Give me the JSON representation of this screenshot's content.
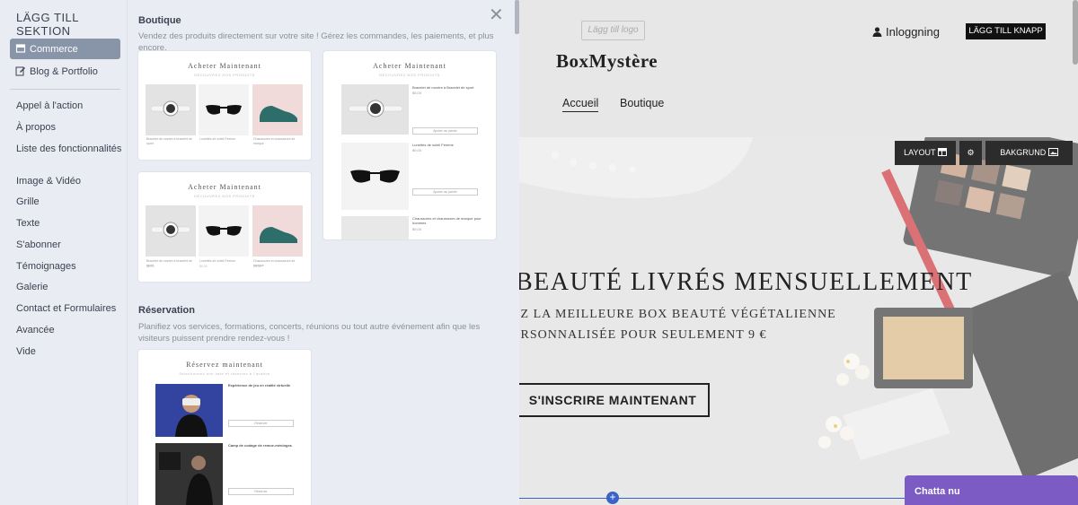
{
  "sidebar": {
    "title": "LÄGG TILL SEKTION",
    "top_items": [
      {
        "label": "Commerce",
        "icon": "store-icon"
      },
      {
        "label": "Blog & Portfolio",
        "icon": "edit-icon"
      }
    ],
    "items": [
      {
        "label": "Appel à l'action"
      },
      {
        "label": "À propos"
      },
      {
        "label": "Liste des fonctionnalités"
      },
      {
        "label": "Image & Vidéo"
      },
      {
        "label": "Grille"
      },
      {
        "label": "Texte"
      },
      {
        "label": "S'abonner"
      },
      {
        "label": "Témoignages"
      },
      {
        "label": "Galerie"
      },
      {
        "label": "Contact et Formulaires"
      },
      {
        "label": "Avancée"
      },
      {
        "label": "Vide"
      }
    ]
  },
  "gallery": {
    "boutique": {
      "title": "Boutique",
      "description": "Vendez des produits directement sur votre site ! Gérez les commandes, les paiements, et plus encore."
    },
    "reservation": {
      "title": "Réservation",
      "description": "Planifiez vos services, formations, concerts, réunions ou tout autre événement afin que les visiteurs puissent prendre rendez-vous !"
    },
    "template_title": "Acheter Maintenant",
    "template_sub": "DÉCOUVREZ NOS PRODUITS",
    "booking_title": "Réservez maintenant",
    "booking_sub": "Sélectionnez une date et réservez à l'avance",
    "product_captions": [
      "Bracelet de montre à bracelet de sport",
      "Lunettes de soleil Femme",
      "Chaussures et chausseurs de marque"
    ],
    "product_prices": [
      "$5,00",
      "$9,00",
      "$9,00"
    ],
    "list_items": [
      {
        "title": "Bracelet de montre à Bracelet de sport",
        "price": "$5,00"
      },
      {
        "title": "Lunettes de soleil Femme",
        "price": "$9,00"
      },
      {
        "title": "Chaussures et chausseurs de marque pour hommes",
        "price": "$9,00"
      }
    ],
    "list_button": "Ajouter au panier",
    "booking_items": [
      {
        "title": "Expérience de jeu en réalité virtuelle",
        "button": "Réserver"
      },
      {
        "title": "Camp de codage de remue-méninges",
        "button": "Réserver"
      }
    ]
  },
  "site": {
    "logo_placeholder": "Lägg till logo",
    "brand": "BoxMystère",
    "login": "Inloggning",
    "add_button": "LÄGG TILL KNAPP",
    "menu": [
      "Accueil",
      "Boutique"
    ],
    "headline": "BEAUTÉ LIVRÉS MENSUELLEMENT",
    "sub1": "EZ LA MEILLEURE BOX BEAUTÉ VÉGÉTALIENNE",
    "sub2": "ERSONNALISÉE POUR SEULEMENT 9 €",
    "cta": "S'INSCRIRE MAINTENANT",
    "toolbar": {
      "layout": "LAYOUT",
      "background": "BAKGRUND"
    },
    "chat": "Chatta nu"
  },
  "colors": {
    "accent": "#8894a8",
    "chat": "#7c5cc4",
    "blue": "#3a62c8"
  }
}
